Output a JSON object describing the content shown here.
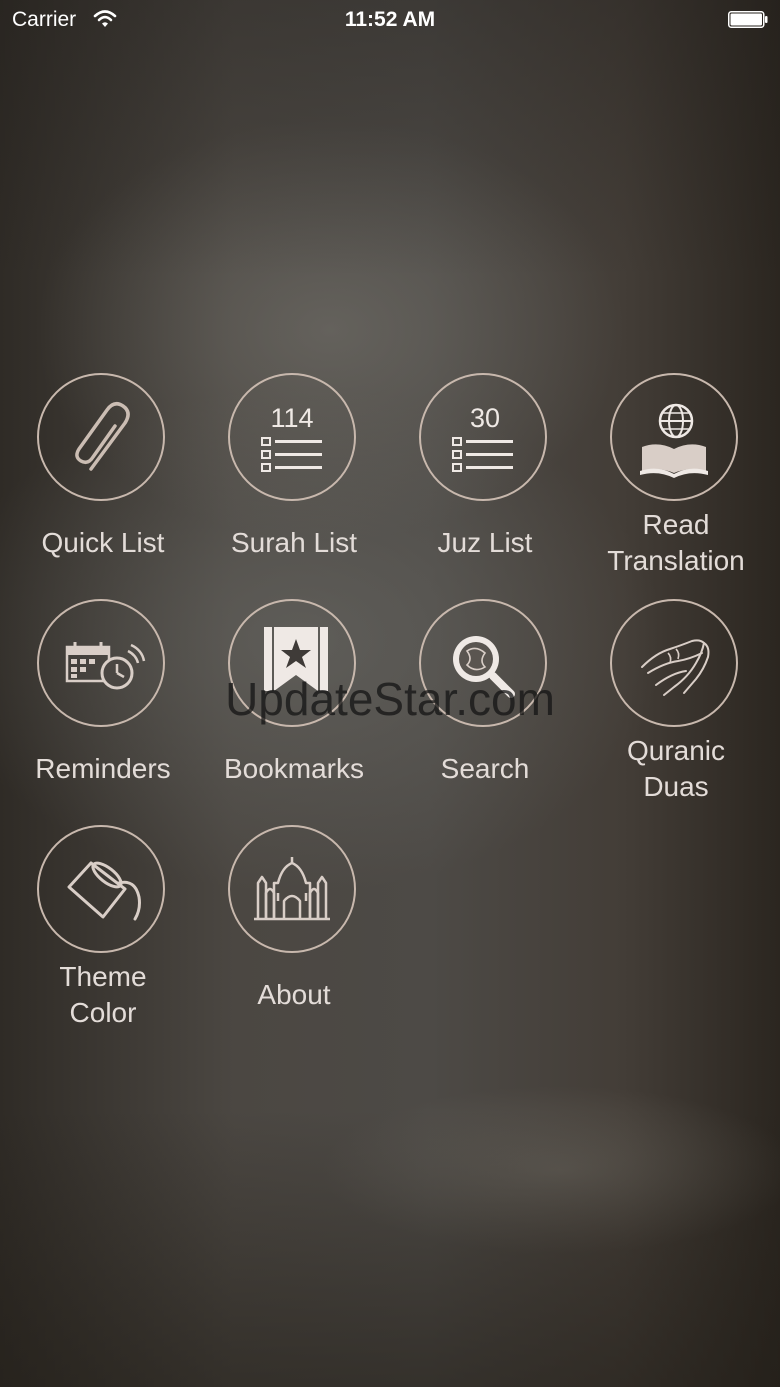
{
  "status_bar": {
    "carrier": "Carrier",
    "time": "11:52 AM",
    "icons": [
      "wifi-icon",
      "battery-icon"
    ]
  },
  "menu": [
    {
      "label": [
        "Quick List"
      ],
      "icon": "paperclip-icon"
    },
    {
      "label": [
        "Surah List"
      ],
      "icon": "list-icon",
      "count": "114"
    },
    {
      "label": [
        "Juz List"
      ],
      "icon": "list-icon",
      "count": "30"
    },
    {
      "label": [
        "Read",
        "Translation"
      ],
      "icon": "book-globe-icon"
    },
    {
      "label": [
        "Reminders"
      ],
      "icon": "calendar-alarm-icon"
    },
    {
      "label": [
        "Bookmarks"
      ],
      "icon": "bookmark-star-icon"
    },
    {
      "label": [
        "Search"
      ],
      "icon": "magnifier-icon"
    },
    {
      "label": [
        "Quranic",
        "Duas"
      ],
      "icon": "praying-hands-icon"
    },
    {
      "label": [
        "Theme",
        "Color"
      ],
      "icon": "paint-bucket-icon"
    },
    {
      "label": [
        "About"
      ],
      "icon": "mosque-icon"
    }
  ],
  "watermark": "UpdateStar.com",
  "colors": {
    "circle_border": "#c8b8ad",
    "label_text": "#e3dcd8"
  }
}
